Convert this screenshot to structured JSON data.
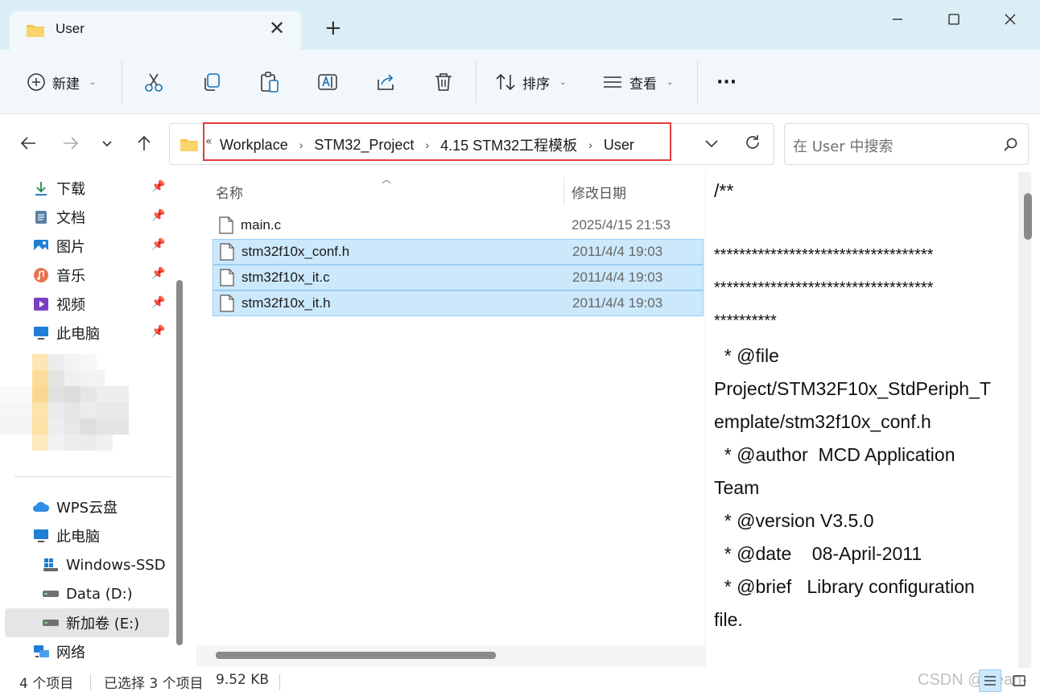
{
  "window": {
    "tab_title": "User",
    "new_tab": "+",
    "close_tab": "✕"
  },
  "toolbar": {
    "new_label": "新建",
    "sort_label": "排序",
    "view_label": "查看",
    "more_label": "···"
  },
  "address": {
    "crumbs": [
      "Workplace",
      "STM32_Project",
      "4.15 STM32工程模板",
      "User"
    ],
    "search_placeholder": "在 User 中搜索"
  },
  "sidebar": {
    "quick_access": [
      {
        "label": "下载",
        "icon": "download-icon"
      },
      {
        "label": "文档",
        "icon": "documents-icon"
      },
      {
        "label": "图片",
        "icon": "pictures-icon"
      },
      {
        "label": "音乐",
        "icon": "music-icon"
      },
      {
        "label": "视频",
        "icon": "videos-icon"
      },
      {
        "label": "此电脑",
        "icon": "computer-icon"
      }
    ],
    "locations": [
      {
        "label": "WPS云盘",
        "icon": "cloud-icon"
      },
      {
        "label": "此电脑",
        "icon": "computer-icon"
      },
      {
        "label": "Windows-SSD",
        "icon": "windows-drive-icon"
      },
      {
        "label": "Data (D:)",
        "icon": "drive-icon"
      },
      {
        "label": "新加卷 (E:)",
        "icon": "drive-icon"
      },
      {
        "label": "网络",
        "icon": "network-icon"
      }
    ]
  },
  "filelist": {
    "columns": {
      "name": "名称",
      "modified": "修改日期"
    },
    "rows": [
      {
        "name": "main.c",
        "modified": "2025/4/15 21:53",
        "selected": false
      },
      {
        "name": "stm32f10x_conf.h",
        "modified": "2011/4/4 19:03",
        "selected": true
      },
      {
        "name": "stm32f10x_it.c",
        "modified": "2011/4/4 19:03",
        "selected": true
      },
      {
        "name": "stm32f10x_it.h",
        "modified": "2011/4/4 19:03",
        "selected": true
      }
    ]
  },
  "preview": {
    "lines": [
      "/**",
      "***********************************",
      "***********************************",
      "**********",
      "  * @file",
      "Project/STM32F10x_StdPeriph_T",
      "emplate/stm32f10x_conf.h",
      "  * @author  MCD Application",
      "Team",
      "  * @version V3.5.0",
      "  * @date    08-April-2011",
      "  * @brief   Library configuration",
      "file."
    ]
  },
  "status": {
    "item_count": "4 个项目",
    "selection": "已选择 3 个项目",
    "size": "9.52 KB",
    "watermark": "CSDN @Sean-"
  },
  "colors": {
    "accent": "#0067c0",
    "selection_bg": "#cce8fb",
    "highlight_box": "#e23c3c",
    "titlebar_bg": "#dceef5"
  }
}
